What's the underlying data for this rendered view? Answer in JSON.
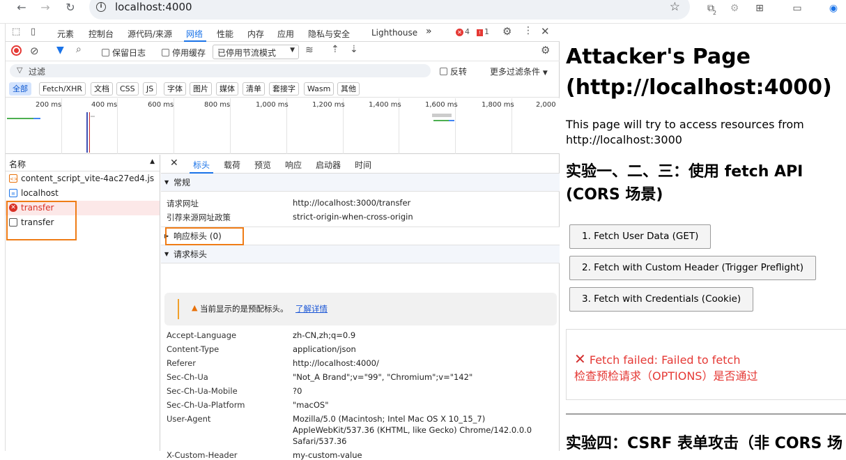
{
  "browser": {
    "url": "localhost:4000",
    "ext_badge": "2"
  },
  "devtools": {
    "tabs": [
      "元素",
      "控制台",
      "源代码/来源",
      "网络",
      "性能",
      "内存",
      "应用",
      "隐私与安全",
      "Lighthouse"
    ],
    "active_tab": "网络",
    "more_tabs": "»",
    "errors": "4",
    "warnings": "1",
    "toolbar": {
      "preserve_log": "保留日志",
      "disable_cache": "停用缓存",
      "throttle": "已停用节流模式"
    },
    "filter": {
      "placeholder": "过滤",
      "invert": "反转",
      "more_filters": "更多过滤条件"
    },
    "chips": [
      "全部",
      "Fetch/XHR",
      "文档",
      "CSS",
      "JS",
      "字体",
      "图片",
      "媒体",
      "清单",
      "套接字",
      "Wasm",
      "其他"
    ],
    "timeline_ticks": [
      "200 ms",
      "400 ms",
      "600 ms",
      "800 ms",
      "1,000 ms",
      "1,200 ms",
      "1,400 ms",
      "1,600 ms",
      "1,800 ms",
      "2,000"
    ],
    "name_header": "名称",
    "requests": [
      {
        "name": "content_script_vite-4ac27ed4.js",
        "icon": "script-icon"
      },
      {
        "name": "localhost",
        "icon": "document-icon"
      },
      {
        "name": "transfer",
        "icon": "error-icon"
      },
      {
        "name": "transfer",
        "icon": "blank-icon"
      }
    ],
    "detail_tabs": [
      "标头",
      "载荷",
      "预览",
      "响应",
      "启动器",
      "时间"
    ],
    "general": {
      "title": "常规",
      "request_url_label": "请求网址",
      "request_url": "http://localhost:3000/transfer",
      "referrer_policy_label": "引荐来源网址政策",
      "referrer_policy": "strict-origin-when-cross-origin"
    },
    "response_headers": "响应标头 (0)",
    "request_headers": {
      "title": "请求标头",
      "warning": "当前显示的是预配标头。",
      "learn_more": "了解详情",
      "rows": [
        {
          "k": "Accept-Language",
          "v": "zh-CN,zh;q=0.9"
        },
        {
          "k": "Content-Type",
          "v": "application/json"
        },
        {
          "k": "Referer",
          "v": "http://localhost:4000/"
        },
        {
          "k": "Sec-Ch-Ua",
          "v": "\"Not_A Brand\";v=\"99\", \"Chromium\";v=\"142\""
        },
        {
          "k": "Sec-Ch-Ua-Mobile",
          "v": "?0"
        },
        {
          "k": "Sec-Ch-Ua-Platform",
          "v": "\"macOS\""
        },
        {
          "k": "User-Agent",
          "v": "Mozilla/5.0 (Macintosh; Intel Mac OS X 10_15_7)"
        },
        {
          "k": "",
          "v": "AppleWebKit/537.36 (KHTML, like Gecko) Chrome/142.0.0.0"
        },
        {
          "k": "",
          "v": "Safari/537.36"
        },
        {
          "k": "X-Custom-Header",
          "v": "my-custom-value"
        }
      ]
    }
  },
  "page": {
    "title_line1": "Attacker's Page",
    "title_line2": "(http://localhost:4000)",
    "intro": "This page will try to access resources from http://localhost:3000",
    "exp_title_line1": "实验一、二、三：使用 fetch API",
    "exp_title_line2": "(CORS 场景)",
    "buttons": [
      "1. Fetch User Data (GET)",
      "2. Fetch with Custom Header (Trigger Preflight)",
      "3. Fetch with Credentials (Cookie)"
    ],
    "error_line1": "Fetch failed: Failed to fetch",
    "error_line2": "检查预检请求（OPTIONS）是否通过",
    "exp4_title": "实验四：CSRF 表单攻击（非 CORS 场"
  }
}
